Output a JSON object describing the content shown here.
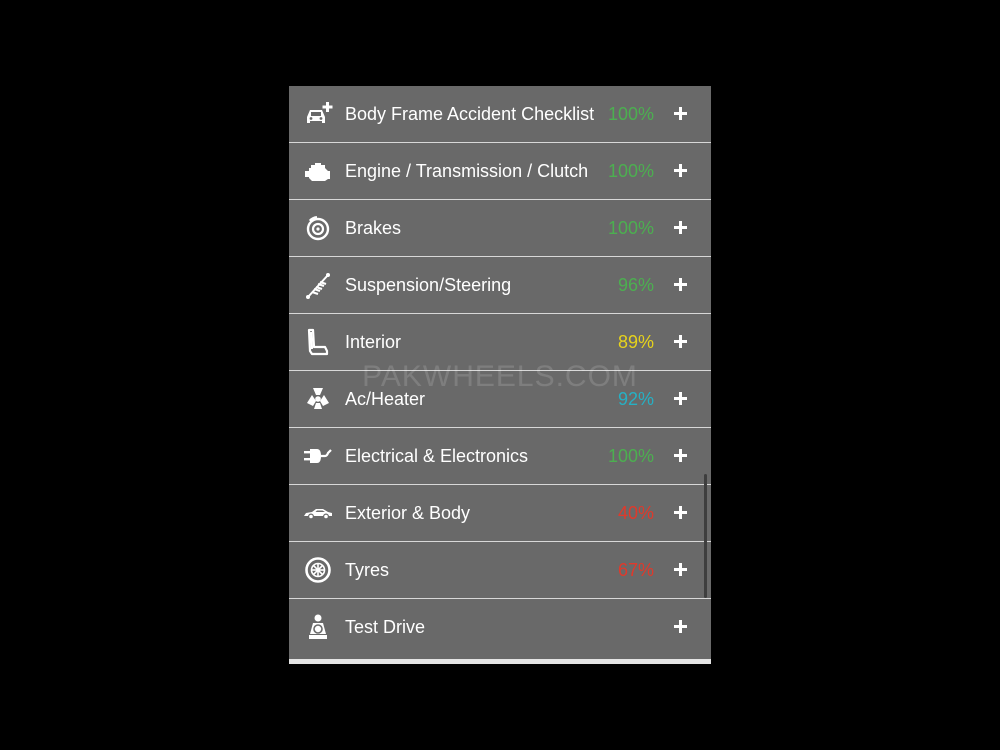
{
  "checklist": {
    "items": [
      {
        "label": "Body Frame Accident Checklist",
        "percent": "100%",
        "percent_color": "#4caf50",
        "icon": "car-plus-icon"
      },
      {
        "label": "Engine / Transmission / Clutch",
        "percent": "100%",
        "percent_color": "#4caf50",
        "icon": "engine-icon"
      },
      {
        "label": "Brakes",
        "percent": "100%",
        "percent_color": "#4caf50",
        "icon": "brake-disc-icon"
      },
      {
        "label": "Suspension/Steering",
        "percent": "96%",
        "percent_color": "#4caf50",
        "icon": "suspension-spring-icon"
      },
      {
        "label": "Interior",
        "percent": "89%",
        "percent_color": "#e6d21c",
        "icon": "car-seat-icon"
      },
      {
        "label": "Ac/Heater",
        "percent": "92%",
        "percent_color": "#26b0c4",
        "icon": "fan-icon"
      },
      {
        "label": "Electrical & Electronics",
        "percent": "100%",
        "percent_color": "#4caf50",
        "icon": "plug-icon"
      },
      {
        "label": "Exterior & Body",
        "percent": "40%",
        "percent_color": "#e0392b",
        "icon": "car-side-icon"
      },
      {
        "label": "Tyres",
        "percent": "67%",
        "percent_color": "#e0392b",
        "icon": "tyre-icon"
      },
      {
        "label": "Test Drive",
        "percent": "",
        "percent_color": "#ffffff",
        "icon": "driver-icon"
      }
    ]
  },
  "watermark": "PAKWHEELS.COM"
}
